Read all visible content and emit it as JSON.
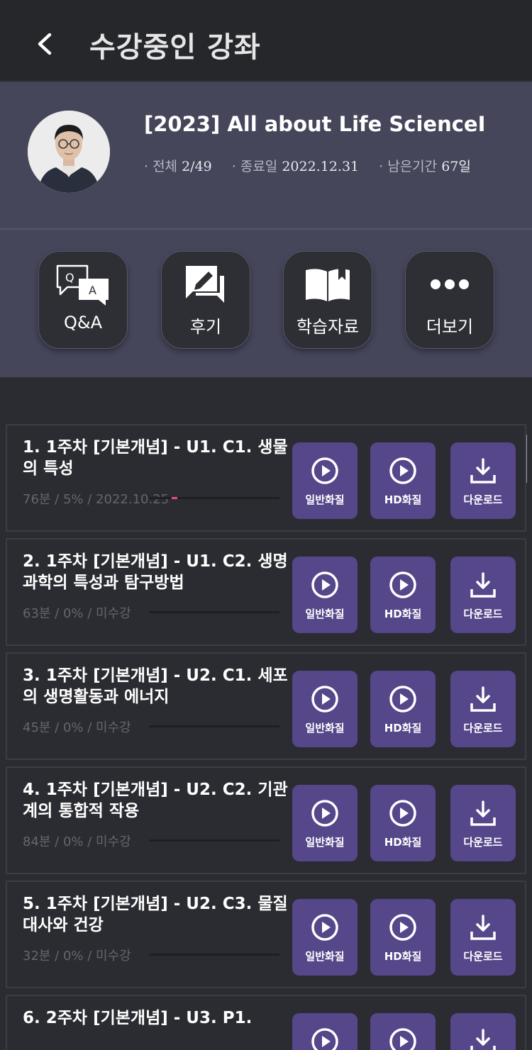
{
  "header": {
    "title": "수강중인 강좌",
    "back_icon": "chevron-left-icon"
  },
  "course": {
    "title": "[2023] All about Life ScienceI",
    "meta": [
      {
        "label": "· 전체",
        "value": "2/49"
      },
      {
        "label": "· 종료일",
        "value": "2022.12.31"
      },
      {
        "label": "· 남은기간",
        "value": "67일"
      }
    ]
  },
  "quick_menu": [
    {
      "label": "Q&A",
      "icon": "qa-icon"
    },
    {
      "label": "후기",
      "icon": "review-icon"
    },
    {
      "label": "학습자료",
      "icon": "book-icon"
    },
    {
      "label": "더보기",
      "icon": "more-icon"
    }
  ],
  "buttons": {
    "normal": "일반화질",
    "hd": "HD화질",
    "download": "다운로드"
  },
  "lectures": [
    {
      "title": "1. 1주차 [기본개념] - U1. C1. 생물의 특성",
      "meta": "76분 / 5% / 2022.10.25",
      "progress": 0.05
    },
    {
      "title": "2. 1주차 [기본개념] - U1. C2. 생명과학의 특성과 탐구방법",
      "meta": "63분 / 0% / 미수강",
      "progress": 0
    },
    {
      "title": "3. 1주차 [기본개념] - U2. C1. 세포의 생명활동과 에너지",
      "meta": "45분 / 0% / 미수강",
      "progress": 0
    },
    {
      "title": "4. 1주차 [기본개념] - U2. C2. 기관계의 통합적 작용",
      "meta": "84분 / 0% / 미수강",
      "progress": 0
    },
    {
      "title": "5. 1주차 [기본개념] - U2. C3. 물질대사와 건강",
      "meta": "32분 / 0% / 미수강",
      "progress": 0
    },
    {
      "title": "6. 2주차 [기본개념] - U3. P1.",
      "meta": "",
      "progress": 0
    }
  ],
  "colors": {
    "accent": "#56468a",
    "progress": "#e84a87",
    "panel": "#45465a",
    "background": "#2b2c31"
  }
}
